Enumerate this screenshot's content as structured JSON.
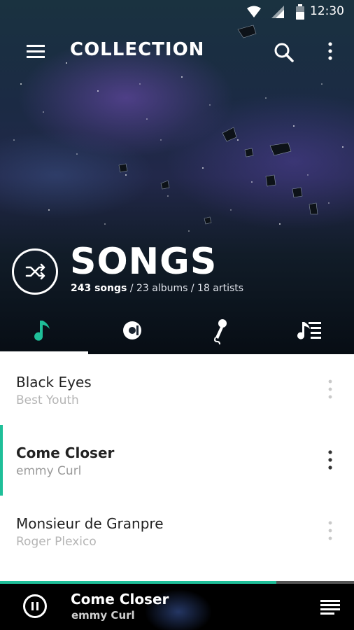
{
  "status_bar": {
    "time": "12:30",
    "icons": [
      "wifi-icon",
      "signal-icon",
      "battery-icon"
    ]
  },
  "toolbar": {
    "title": "COLLECTION",
    "menu_icon": "menu-icon",
    "search_icon": "search-icon",
    "more_icon": "more-vert-icon"
  },
  "header": {
    "section_title": "SONGS",
    "counts": {
      "songs": "243 songs",
      "rest": " / 23 albums / 18 artists"
    },
    "shuffle_icon": "shuffle-icon"
  },
  "tabs": [
    {
      "name": "songs",
      "icon": "music-note-icon",
      "selected": true
    },
    {
      "name": "albums",
      "icon": "disc-icon",
      "selected": false
    },
    {
      "name": "artists",
      "icon": "microphone-icon",
      "selected": false
    },
    {
      "name": "playlists",
      "icon": "playlist-icon",
      "selected": false
    }
  ],
  "songs": [
    {
      "title": "Black Eyes",
      "artist": "Best Youth",
      "playing": false
    },
    {
      "title": "Come Closer",
      "artist": "emmy Curl",
      "playing": true
    },
    {
      "title": "Monsieur de Granpre",
      "artist": "Roger Plexico",
      "playing": false
    }
  ],
  "now_playing": {
    "title": "Come Closer",
    "artist": "emmy Curl",
    "progress": 0.78
  },
  "colors": {
    "accent": "#1fbf99",
    "list_bg": "#ffffff",
    "player_bg": "#000000"
  }
}
